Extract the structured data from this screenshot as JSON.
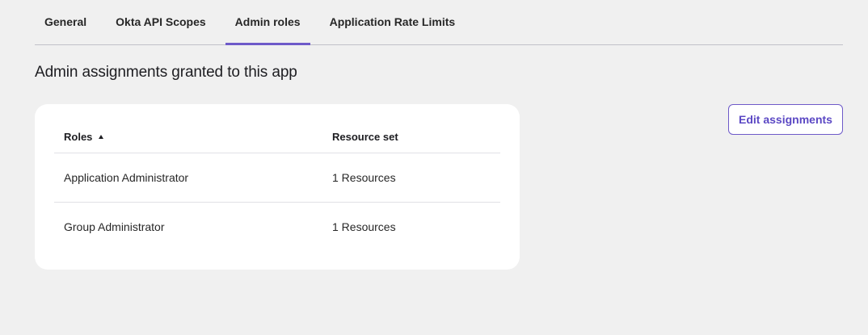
{
  "tabs": [
    {
      "label": "General",
      "active": false
    },
    {
      "label": "Okta API Scopes",
      "active": false
    },
    {
      "label": "Admin roles",
      "active": true
    },
    {
      "label": "Application Rate Limits",
      "active": false
    }
  ],
  "section": {
    "title": "Admin assignments granted to this app"
  },
  "table": {
    "headers": {
      "roles": "Roles",
      "resource_set": "Resource set"
    },
    "sort": {
      "column": "roles",
      "direction": "ascending",
      "icon": "sort-up-icon"
    },
    "rows": [
      {
        "role": "Application Administrator",
        "resource": "1 Resources"
      },
      {
        "role": "Group Administrator",
        "resource": "1 Resources"
      }
    ]
  },
  "actions": {
    "edit_label": "Edit assignments"
  },
  "colors": {
    "accent": "#6e5ac9",
    "background": "#f0f0f0",
    "card": "#ffffff"
  }
}
